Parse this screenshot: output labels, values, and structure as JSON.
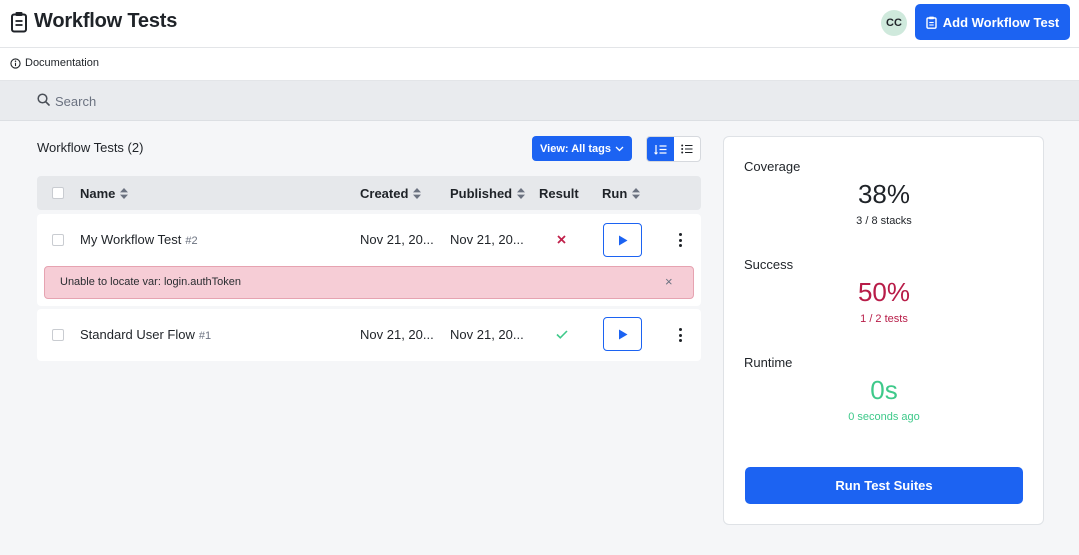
{
  "header": {
    "title": "Workflow Tests",
    "app_icon": "clipboard-icon",
    "avatar_initials": "CC",
    "add_button_label": "Add Workflow Test",
    "add_button_icon": "clipboard-icon"
  },
  "docbar": {
    "link_label": "Documentation",
    "link_icon": "info-icon"
  },
  "search": {
    "placeholder": "Search",
    "value": ""
  },
  "list": {
    "title": "Workflow Tests (2)",
    "view_filter_label": "View: All tags",
    "columns": [
      "Name",
      "Created",
      "Published",
      "Result",
      "Run"
    ],
    "rows": [
      {
        "name": "My Workflow Test",
        "number": "#2",
        "created": "Nov 21, 20...",
        "published": "Nov 21, 20...",
        "result": "fail",
        "result_icon": "x-icon"
      },
      {
        "name": "Standard User Flow",
        "number": "#1",
        "created": "Nov 21, 20...",
        "published": "Nov 21, 20...",
        "result": "pass",
        "result_icon": "check-icon"
      }
    ],
    "error_message": "Unable to locate var: login.authToken",
    "error_close": "×"
  },
  "stats": {
    "coverage": {
      "label": "Coverage",
      "value": "38%",
      "sub": "3 / 8 stacks"
    },
    "success": {
      "label": "Success",
      "value": "50%",
      "sub": "1 / 2 tests"
    },
    "runtime": {
      "label": "Runtime",
      "value": "0s",
      "sub": "0 seconds ago"
    },
    "run_button_label": "Run Test Suites"
  },
  "colors": {
    "accent": "#1c63f2",
    "fail": "#c0204a",
    "success_stat": "#b81c48",
    "runtime_stat": "#3ec98a",
    "error_bg": "#f6cdd6",
    "check": "#3ec98a"
  }
}
